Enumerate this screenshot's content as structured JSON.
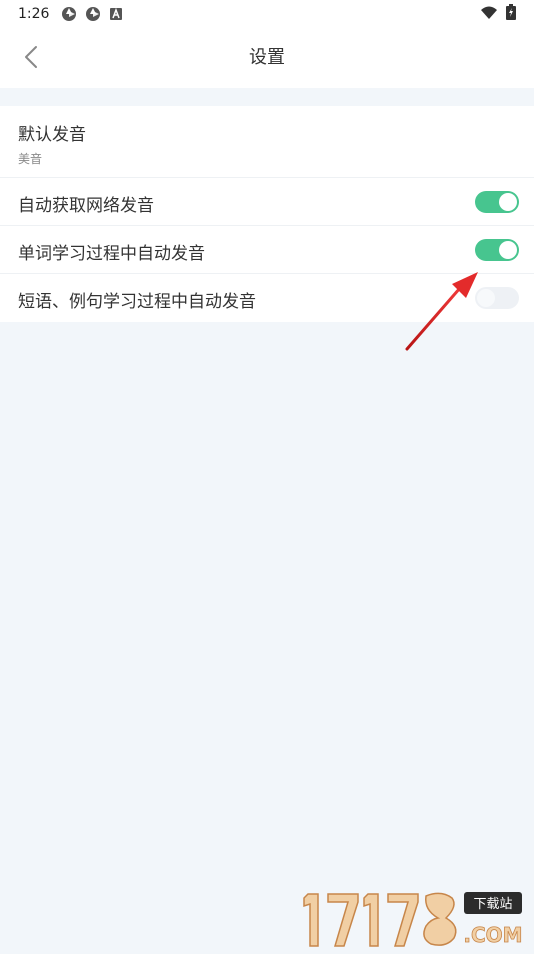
{
  "status_bar": {
    "time": "1:26",
    "icons": [
      "aperture-icon",
      "aperture-icon",
      "a-box-icon",
      "wifi-icon",
      "battery-charging-icon"
    ]
  },
  "header": {
    "title": "设置",
    "back_icon": "chevron-left-icon"
  },
  "settings": {
    "default_pronunciation": {
      "label": "默认发音",
      "value": "美音"
    },
    "toggles": [
      {
        "label": "自动获取网络发音",
        "on": true
      },
      {
        "label": "单词学习过程中自动发音",
        "on": true
      },
      {
        "label": "短语、例句学习过程中自动发音",
        "on": false
      }
    ]
  },
  "annotation": {
    "arrow_icon": "red-arrow-icon",
    "color": "#e32b2b"
  },
  "watermark": {
    "brand": "17178",
    "tag": "下载站",
    "domain": ".COM"
  },
  "colors": {
    "toggle_on": "#47c58f",
    "toggle_off": "#eef1f5",
    "background": "#f2f6fa"
  }
}
